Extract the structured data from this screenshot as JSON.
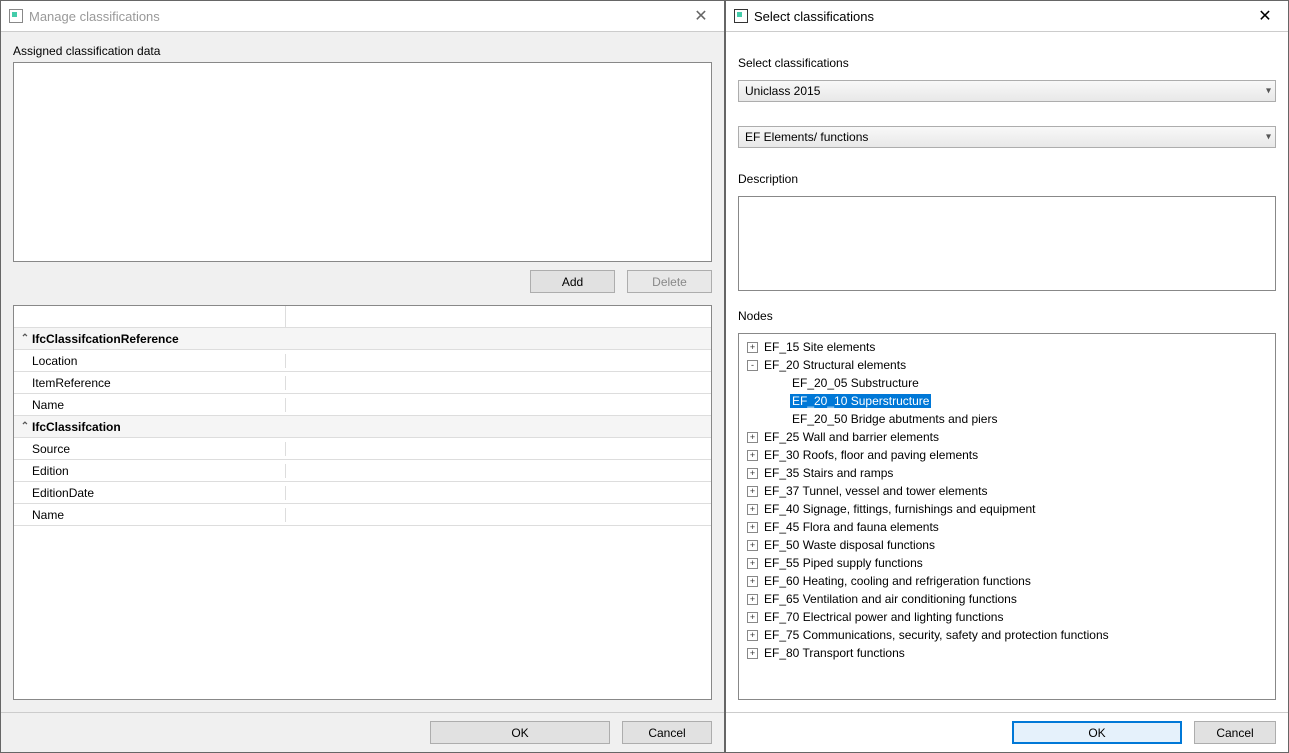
{
  "left": {
    "title": "Manage classifications",
    "assigned_label": "Assigned classification data",
    "add_label": "Add",
    "delete_label": "Delete",
    "groups": [
      {
        "header": "IfcClassifcationReference",
        "rows": [
          {
            "k": "Location",
            "v": ""
          },
          {
            "k": "ItemReference",
            "v": ""
          },
          {
            "k": "Name",
            "v": ""
          }
        ]
      },
      {
        "header": "IfcClassifcation",
        "rows": [
          {
            "k": "Source",
            "v": ""
          },
          {
            "k": "Edition",
            "v": ""
          },
          {
            "k": "EditionDate",
            "v": ""
          },
          {
            "k": "Name",
            "v": ""
          }
        ]
      }
    ],
    "ok_label": "OK",
    "cancel_label": "Cancel"
  },
  "right": {
    "title": "Select classifications",
    "select_label": "Select classifications",
    "system_value": "Uniclass 2015",
    "table_value": "EF Elements/ functions",
    "description_label": "Description",
    "description_value": "",
    "nodes_label": "Nodes",
    "tree": [
      {
        "indent": 0,
        "exp": "+",
        "label": "EF_15 Site elements",
        "selected": false
      },
      {
        "indent": 0,
        "exp": "-",
        "label": "EF_20 Structural elements",
        "selected": false
      },
      {
        "indent": 1,
        "exp": "",
        "label": "EF_20_05 Substructure",
        "selected": false
      },
      {
        "indent": 1,
        "exp": "",
        "label": "EF_20_10 Superstructure",
        "selected": true
      },
      {
        "indent": 1,
        "exp": "",
        "label": "EF_20_50 Bridge abutments and piers",
        "selected": false
      },
      {
        "indent": 0,
        "exp": "+",
        "label": "EF_25 Wall and barrier elements",
        "selected": false
      },
      {
        "indent": 0,
        "exp": "+",
        "label": "EF_30 Roofs, floor and paving elements",
        "selected": false
      },
      {
        "indent": 0,
        "exp": "+",
        "label": "EF_35 Stairs and ramps",
        "selected": false
      },
      {
        "indent": 0,
        "exp": "+",
        "label": "EF_37 Tunnel, vessel and tower elements",
        "selected": false
      },
      {
        "indent": 0,
        "exp": "+",
        "label": "EF_40 Signage, fittings, furnishings and equipment",
        "selected": false
      },
      {
        "indent": 0,
        "exp": "+",
        "label": "EF_45 Flora and fauna elements",
        "selected": false
      },
      {
        "indent": 0,
        "exp": "+",
        "label": "EF_50 Waste disposal functions",
        "selected": false
      },
      {
        "indent": 0,
        "exp": "+",
        "label": "EF_55 Piped supply functions",
        "selected": false
      },
      {
        "indent": 0,
        "exp": "+",
        "label": "EF_60 Heating, cooling and refrigeration functions",
        "selected": false
      },
      {
        "indent": 0,
        "exp": "+",
        "label": "EF_65 Ventilation and air conditioning functions",
        "selected": false
      },
      {
        "indent": 0,
        "exp": "+",
        "label": "EF_70 Electrical power and lighting functions",
        "selected": false
      },
      {
        "indent": 0,
        "exp": "+",
        "label": "EF_75 Communications, security, safety and protection functions",
        "selected": false
      },
      {
        "indent": 0,
        "exp": "+",
        "label": "EF_80 Transport functions",
        "selected": false
      }
    ],
    "ok_label": "OK",
    "cancel_label": "Cancel"
  }
}
